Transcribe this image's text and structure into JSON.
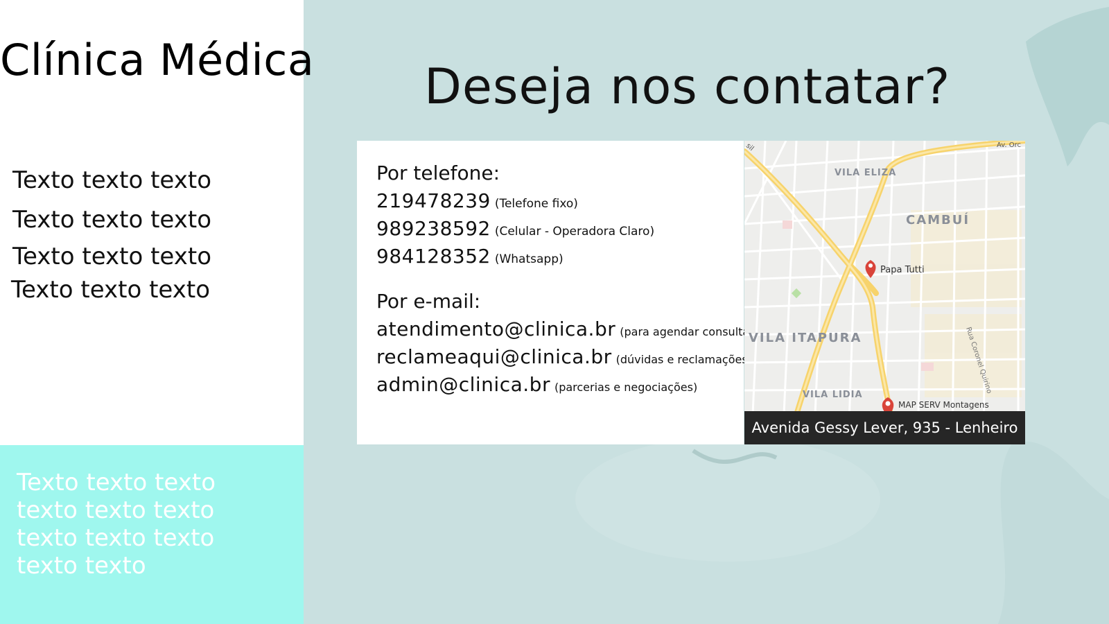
{
  "brand": {
    "title": "Clínica Médica"
  },
  "left_lines": [
    "Texto texto texto",
    "Texto texto texto",
    "Texto texto texto",
    "Texto texto texto"
  ],
  "bottom_text": "Texto texto texto\ntexto texto texto\ntexto texto texto\ntexto texto",
  "heading": "Deseja nos contatar?",
  "phone": {
    "label": "Por telefone:",
    "entries": [
      {
        "number": "219478239",
        "note": "(Telefone fixo)"
      },
      {
        "number": "989238592",
        "note": "(Celular - Operadora Claro)"
      },
      {
        "number": "984128352",
        "note": "(Whatsapp)"
      }
    ]
  },
  "email": {
    "label": "Por e-mail:",
    "entries": [
      {
        "address": "atendimento@clinica.br",
        "note": "(para agendar consulta)"
      },
      {
        "address": "reclameaqui@clinica.br",
        "note": "(dúvidas e reclamações)"
      },
      {
        "address": "admin@clinica.br",
        "note": "(parcerias e negociações)"
      }
    ]
  },
  "map": {
    "labels": {
      "vila_eliza": "VILA ELIZA",
      "cambui": "CAMBUÍ",
      "papa_tutti": "Papa Tutti",
      "vila_itapura": "VILA ITAPURA",
      "rua_coronel": "Rua Coronel Quirino",
      "vila_lidia": "VILA LIDIA",
      "map_serv": "MAP SERV Montagens",
      "av_orc": "Av. Orc",
      "edge_left": "sil"
    },
    "caption": "Avenida Gessy Lever, 935 - Lenheiro",
    "road_color": "#f7d36b",
    "pin_color": "#d9443a"
  }
}
